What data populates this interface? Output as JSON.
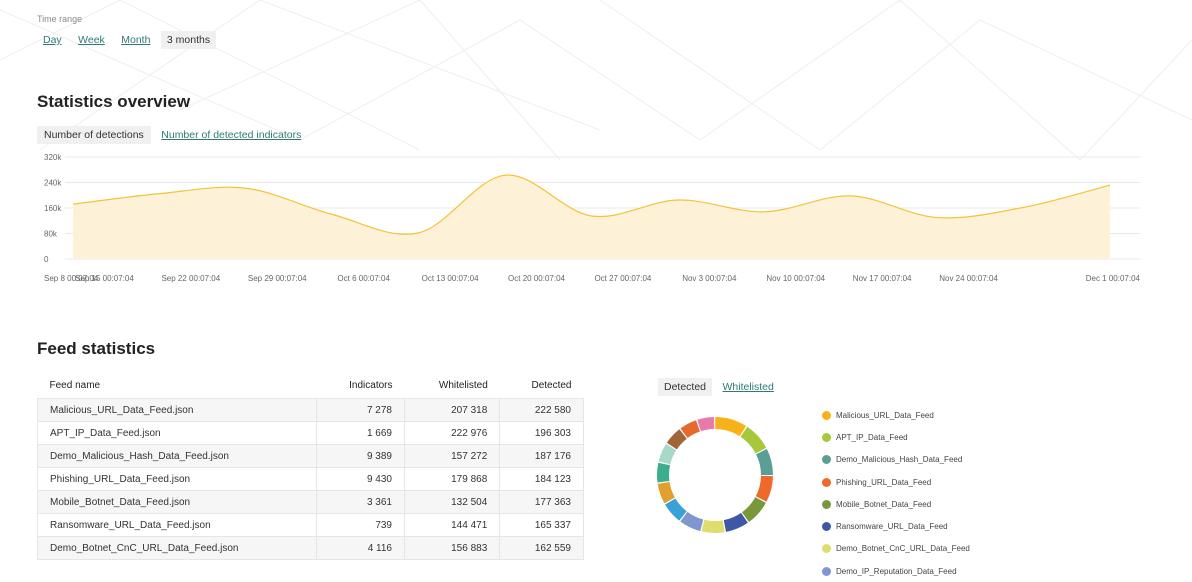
{
  "time_range": {
    "label": "Time range",
    "options": [
      "Day",
      "Week",
      "Month",
      "3 months"
    ],
    "selected": "3 months"
  },
  "overview": {
    "title": "Statistics overview",
    "tabs": [
      "Number of detections",
      "Number of detected indicators"
    ],
    "active_tab": "Number of detections"
  },
  "chart_data": {
    "type": "area",
    "x": [
      "Sep 8 00:07:04",
      "Sep 15 00:07:04",
      "Sep 22 00:07:04",
      "Sep 29 00:07:04",
      "Oct 6 00:07:04",
      "Oct 13 00:07:04",
      "Oct 20 00:07:04",
      "Oct 27 00:07:04",
      "Nov 3 00:07:04",
      "Nov 10 00:07:04",
      "Nov 17 00:07:04",
      "Nov 24 00:07:04",
      "Dec 1 00:07:04"
    ],
    "values": [
      172000,
      205000,
      222000,
      140000,
      82000,
      263000,
      135000,
      185000,
      148000,
      198000,
      130000,
      162000,
      232000
    ],
    "ylim": [
      0,
      320000
    ],
    "yticks": [
      "0",
      "80k",
      "160k",
      "240k",
      "320k"
    ],
    "grid": true,
    "colors": {
      "line": "#f3c33a",
      "fill": "#fdf1d8"
    }
  },
  "feed": {
    "title": "Feed statistics",
    "columns": [
      "Feed name",
      "Indicators",
      "Whitelisted",
      "Detected"
    ],
    "rows": [
      [
        "Malicious_URL_Data_Feed.json",
        "7 278",
        "207 318",
        "222 580"
      ],
      [
        "APT_IP_Data_Feed.json",
        "1 669",
        "222 976",
        "196 303"
      ],
      [
        "Demo_Malicious_Hash_Data_Feed.json",
        "9 389",
        "157 272",
        "187 176"
      ],
      [
        "Phishing_URL_Data_Feed.json",
        "9 430",
        "179 868",
        "184 123"
      ],
      [
        "Mobile_Botnet_Data_Feed.json",
        "3 361",
        "132 504",
        "177 363"
      ],
      [
        "Ransomware_URL_Data_Feed.json",
        "739",
        "144 471",
        "165 337"
      ],
      [
        "Demo_Botnet_CnC_URL_Data_Feed.json",
        "4 116",
        "156 883",
        "162 559"
      ]
    ]
  },
  "donut": {
    "tabs": [
      "Detected",
      "Whitelisted"
    ],
    "active_tab": "Detected",
    "legend": [
      {
        "name": "Malicious_URL_Data_Feed",
        "color": "#f7b21a"
      },
      {
        "name": "APT_IP_Data_Feed",
        "color": "#a7c83a"
      },
      {
        "name": "Demo_Malicious_Hash_Data_Feed",
        "color": "#5a9e95"
      },
      {
        "name": "Phishing_URL_Data_Feed",
        "color": "#ee6a2c"
      },
      {
        "name": "Mobile_Botnet_Data_Feed",
        "color": "#79983a"
      },
      {
        "name": "Ransomware_URL_Data_Feed",
        "color": "#3f58a6"
      },
      {
        "name": "Demo_Botnet_CnC_URL_Data_Feed",
        "color": "#dede6e"
      },
      {
        "name": "Demo_IP_Reputation_Data_Feed",
        "color": "#7f96cf"
      }
    ],
    "segments": [
      {
        "value": 222580,
        "color": "#f7b21a"
      },
      {
        "value": 196303,
        "color": "#a7c83a"
      },
      {
        "value": 187176,
        "color": "#5a9e95"
      },
      {
        "value": 184123,
        "color": "#ee6a2c"
      },
      {
        "value": 177363,
        "color": "#79983a"
      },
      {
        "value": 165337,
        "color": "#3f58a6"
      },
      {
        "value": 162559,
        "color": "#dede6e"
      },
      {
        "value": 155000,
        "color": "#7f96cf"
      },
      {
        "value": 150000,
        "color": "#3aa0d8"
      },
      {
        "value": 145000,
        "color": "#e0a030"
      },
      {
        "value": 140000,
        "color": "#3cae8e"
      },
      {
        "value": 135000,
        "color": "#a8d8c8"
      },
      {
        "value": 130000,
        "color": "#a0663a"
      },
      {
        "value": 125000,
        "color": "#e46a30"
      },
      {
        "value": 120000,
        "color": "#e87aaa"
      }
    ]
  }
}
